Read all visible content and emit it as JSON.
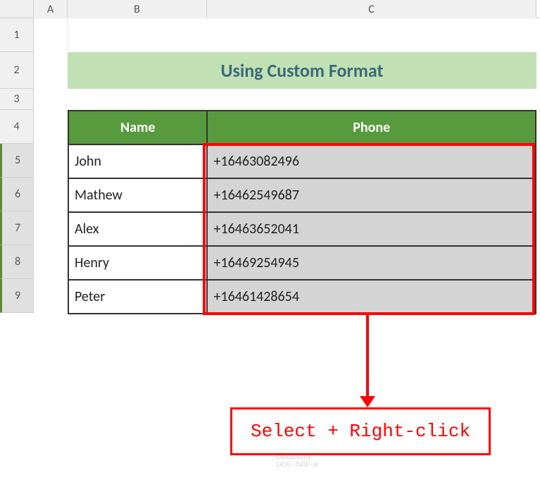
{
  "columns": {
    "a": "A",
    "b": "B",
    "c": "C"
  },
  "row_numbers": [
    "1",
    "2",
    "3",
    "4",
    "5",
    "6",
    "7",
    "8",
    "9"
  ],
  "title": "Using Custom Format",
  "table": {
    "headers": {
      "name": "Name",
      "phone": "Phone"
    },
    "rows": [
      {
        "name": "John",
        "phone": "+16463082496"
      },
      {
        "name": "Mathew",
        "phone": "+16462549687"
      },
      {
        "name": "Alex",
        "phone": "+16463652041"
      },
      {
        "name": "Henry",
        "phone": "+16469254945"
      },
      {
        "name": "Peter",
        "phone": "+16461428654"
      }
    ]
  },
  "callout": "Select + Right-click",
  "watermark": {
    "brand": "exceldemy",
    "sub": "EXCEL · DATA · BI"
  }
}
